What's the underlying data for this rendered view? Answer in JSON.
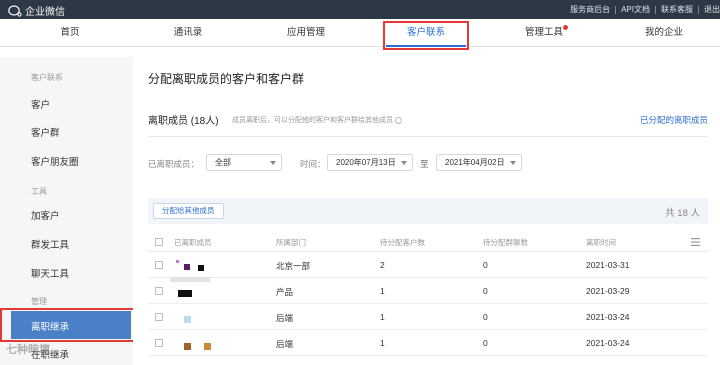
{
  "topbar": {
    "brand": "企业微信",
    "links": [
      "服务商后台",
      "API文档",
      "联系客服",
      "退出"
    ]
  },
  "nav": {
    "items": [
      "首页",
      "通讯录",
      "应用管理",
      "客户联系",
      "管理工具",
      "我的企业"
    ],
    "active": "客户联系"
  },
  "sidebar": {
    "group1": "客户联系",
    "items1": [
      "客户",
      "客户群",
      "客户朋友圈"
    ],
    "group2": "工具",
    "items2": [
      "加客户",
      "群发工具",
      "聊天工具"
    ],
    "group3": "管理",
    "active_item": "离职继承",
    "partial_item": "在职继承"
  },
  "main": {
    "title": "分配离职成员的客户和客户群",
    "members_title": "离职成员 (18人)",
    "members_desc": "成员离职后，可以分配他的客户和客户群给其他成员",
    "assigned_link": "已分配的离职成员",
    "filter": {
      "member_label": "已离职成员：",
      "member_value": "全部",
      "time_label": "时间：",
      "start_date": "2020年07月13日",
      "to": "至",
      "end_date": "2021年04月02日"
    },
    "assign_button": "分配给其他成员",
    "total": "共 18 人",
    "columns": [
      "已离职成员",
      "所属部门",
      "待分配客户数",
      "待分配群聊数",
      "离职时间"
    ],
    "rows": [
      {
        "dept": "北京一部",
        "customers": "2",
        "groups": "0",
        "time": "2021-03-31"
      },
      {
        "dept": "产品",
        "customers": "1",
        "groups": "0",
        "time": "2021-03-29"
      },
      {
        "dept": "后端",
        "customers": "1",
        "groups": "0",
        "time": "2021-03-24"
      },
      {
        "dept": "后端",
        "customers": "1",
        "groups": "0",
        "time": "2021-03-24"
      }
    ]
  },
  "colors": {
    "topbar": "#2c3845",
    "accent": "#2b6fd6",
    "highlight_box": "#e53935",
    "sidebar_active": "#4b80c6"
  },
  "watermark": "七种暗壇"
}
